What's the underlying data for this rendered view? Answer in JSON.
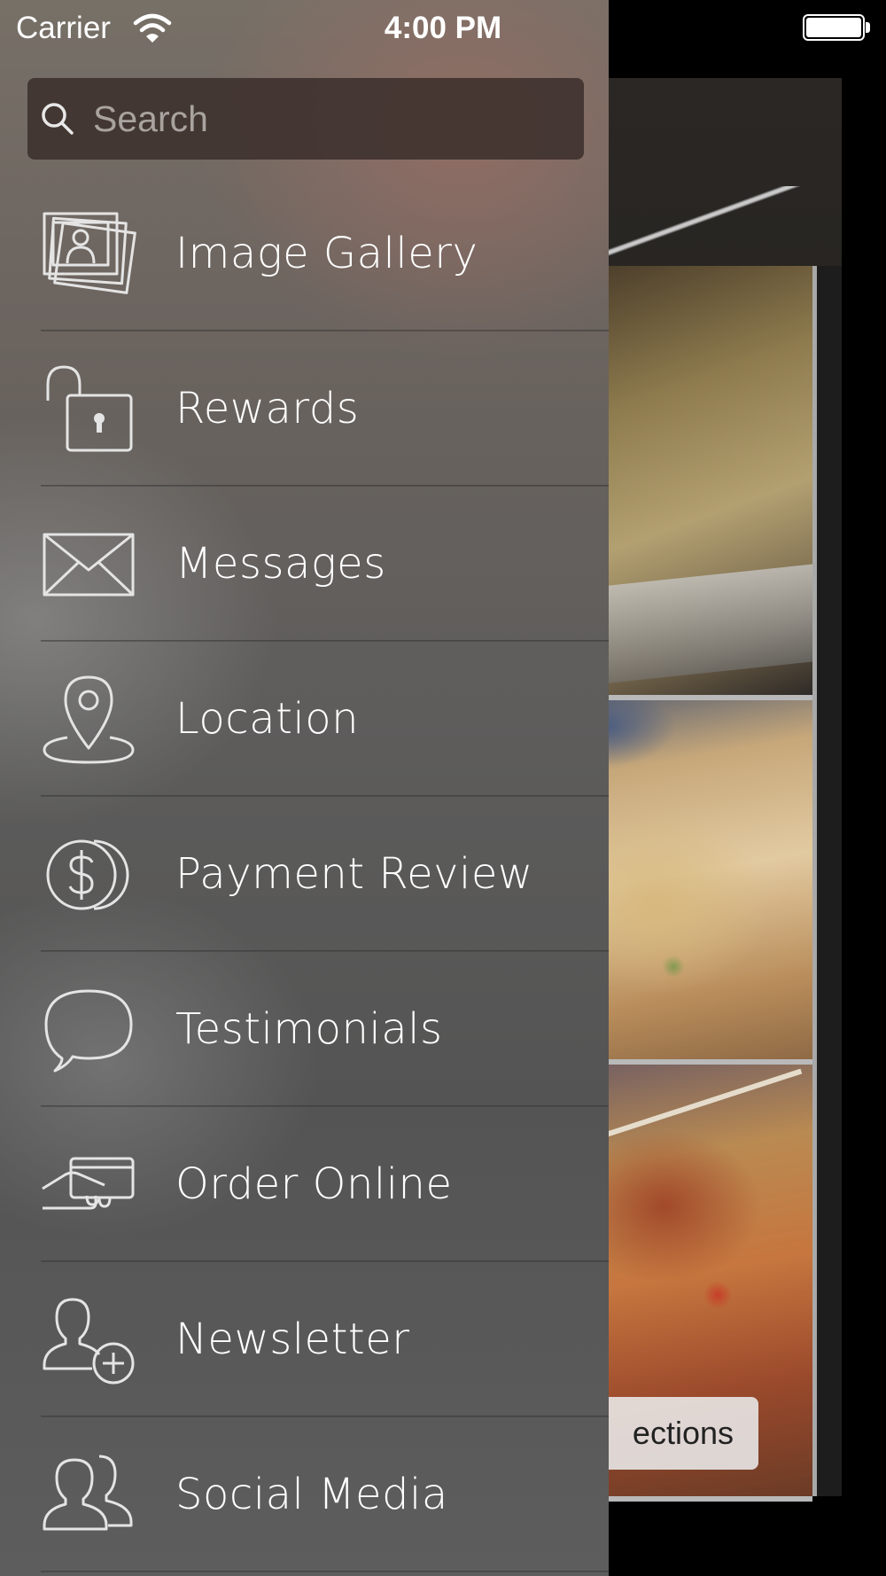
{
  "status_bar": {
    "carrier": "Carrier",
    "time": "4:00 PM"
  },
  "search": {
    "placeholder": "Search",
    "value": ""
  },
  "menu": {
    "items": [
      {
        "label": "Image Gallery",
        "icon": "image-gallery-icon"
      },
      {
        "label": "Rewards",
        "icon": "unlocked-padlock-icon"
      },
      {
        "label": "Messages",
        "icon": "envelope-icon"
      },
      {
        "label": "Location",
        "icon": "map-pin-icon"
      },
      {
        "label": "Payment Review",
        "icon": "coins-dollar-icon"
      },
      {
        "label": "Testimonials",
        "icon": "speech-bubble-icon"
      },
      {
        "label": "Order Online",
        "icon": "hand-card-icon"
      },
      {
        "label": "Newsletter",
        "icon": "add-user-icon"
      },
      {
        "label": "Social Media",
        "icon": "users-group-icon"
      }
    ]
  },
  "background": {
    "directions_button_label": "ections"
  },
  "colors": {
    "drawer_tint": "#66615d",
    "text": "#ffffff",
    "icon_stroke": "#e4e4e4",
    "search_bg": "#3c302c"
  }
}
